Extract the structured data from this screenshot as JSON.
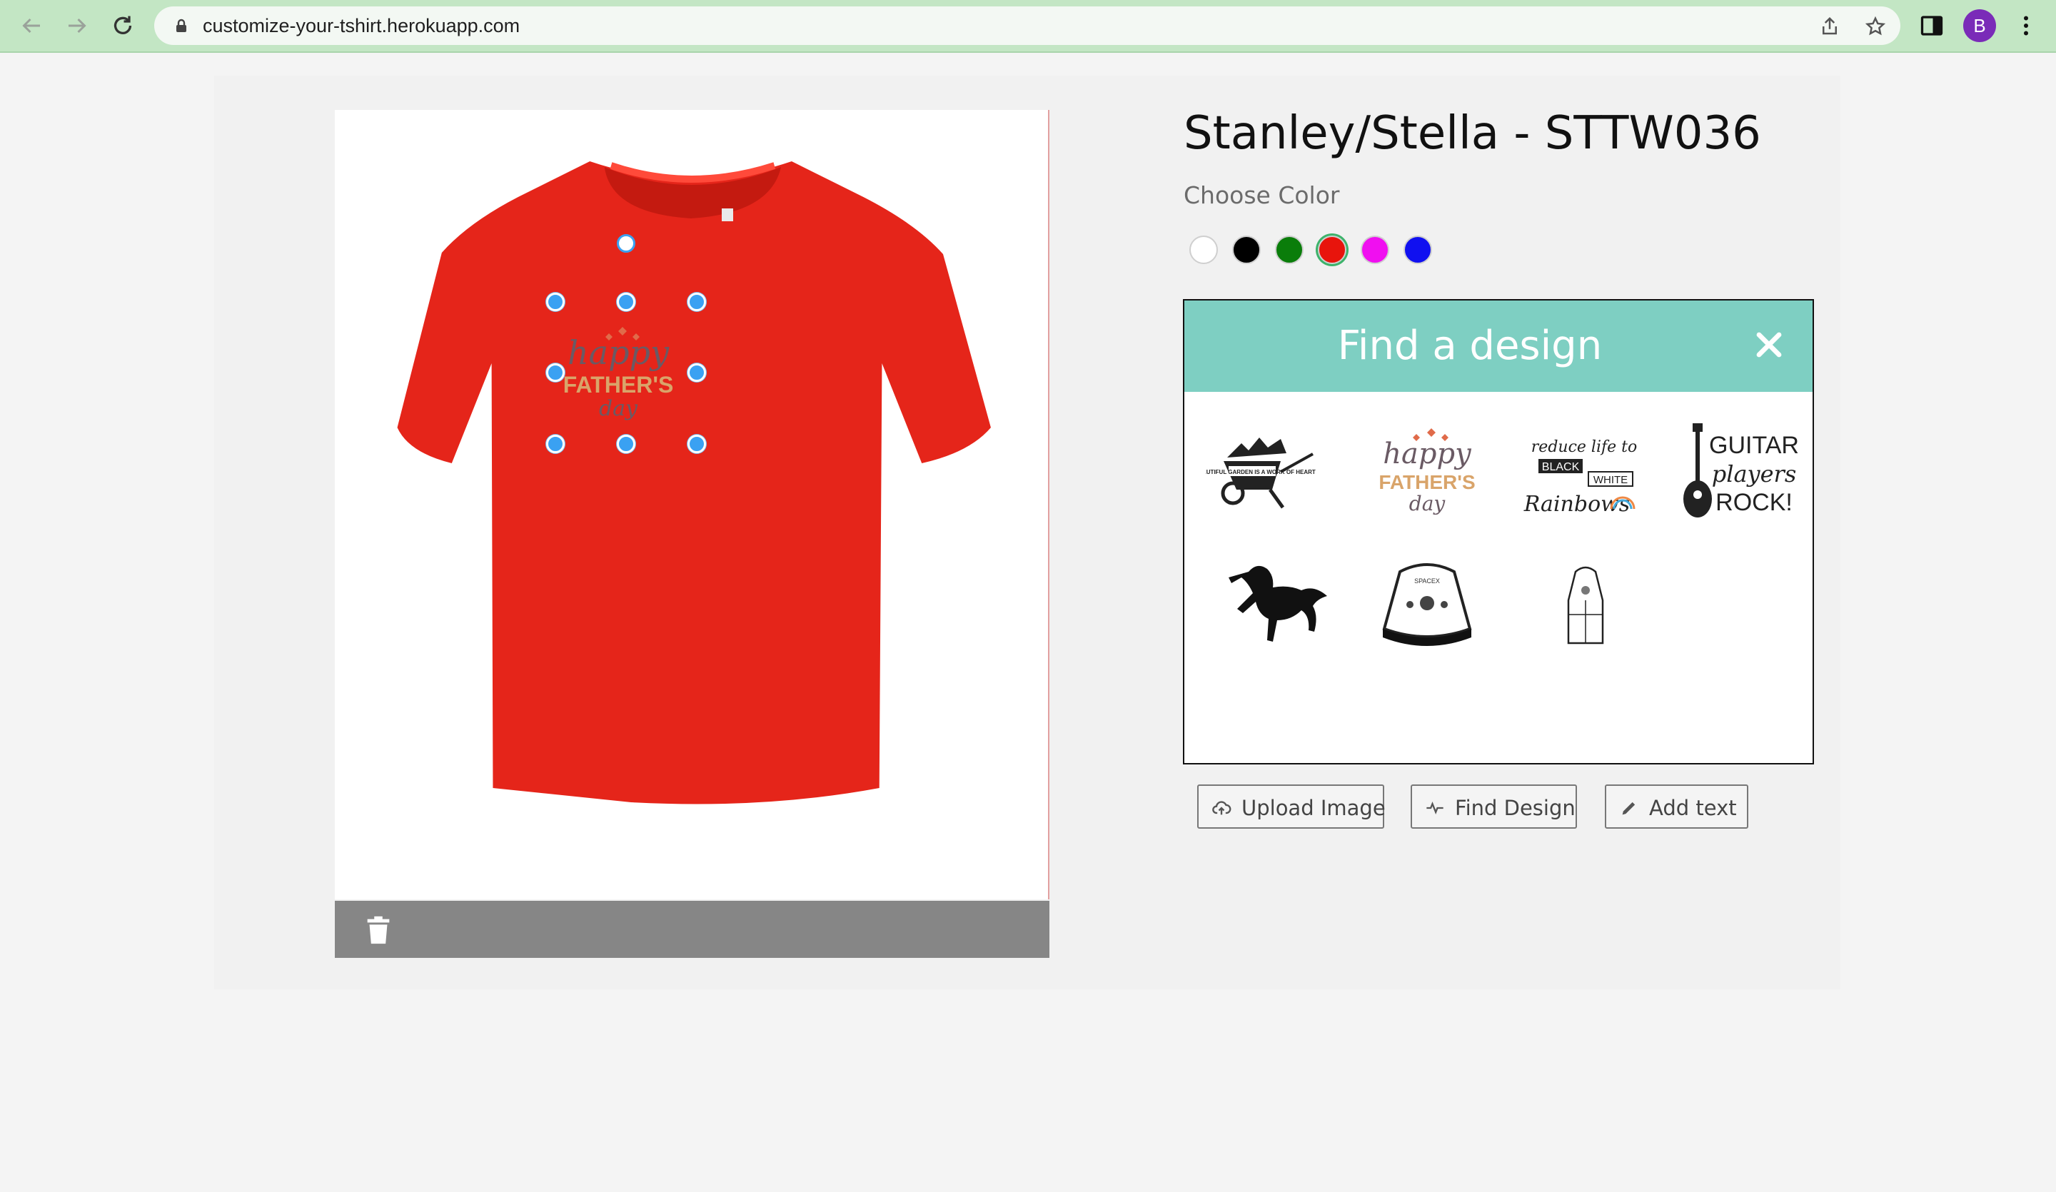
{
  "browser": {
    "url": "customize-your-tshirt.herokuapp.com",
    "profile_initial": "B"
  },
  "product": {
    "title": "Stanley/Stella - STTW036",
    "color_label": "Choose Color",
    "shirt_color": "#e5251a",
    "colors": [
      {
        "name": "white",
        "hex": "#ffffff",
        "selected": false
      },
      {
        "name": "black",
        "hex": "#000000",
        "selected": false
      },
      {
        "name": "green",
        "hex": "#0a7d0a",
        "selected": false
      },
      {
        "name": "red",
        "hex": "#e8140c",
        "selected": true
      },
      {
        "name": "magenta",
        "hex": "#f00ff0",
        "selected": false
      },
      {
        "name": "blue",
        "hex": "#1010f0",
        "selected": false
      }
    ]
  },
  "canvas": {
    "design_on_shirt": {
      "line1": "happy",
      "line2": "FATHER'S",
      "line3": "day"
    }
  },
  "design_modal": {
    "title": "Find a design",
    "designs": [
      {
        "name": "wheelbarrow-garden",
        "text": "A BEAUTIFUL GARDEN IS A WORK OF HEART"
      },
      {
        "name": "happy-fathers-day",
        "line1": "happy",
        "line2": "FATHER'S",
        "line3": "day"
      },
      {
        "name": "black-white-rainbows",
        "line1": "reduce life to",
        "line2": "BLACK",
        "line3": "WHITE",
        "line4": "Rainbows"
      },
      {
        "name": "guitar-players-rock",
        "line1": "GUITAR",
        "line2": "players",
        "line3": "ROCK!"
      },
      {
        "name": "black-horse"
      },
      {
        "name": "space-capsule",
        "text": "SPACEX"
      },
      {
        "name": "rocket-capsule"
      }
    ]
  },
  "actions": {
    "upload_label": "Upload Image",
    "find_label": "Find Design",
    "add_text_label": "Add text"
  }
}
